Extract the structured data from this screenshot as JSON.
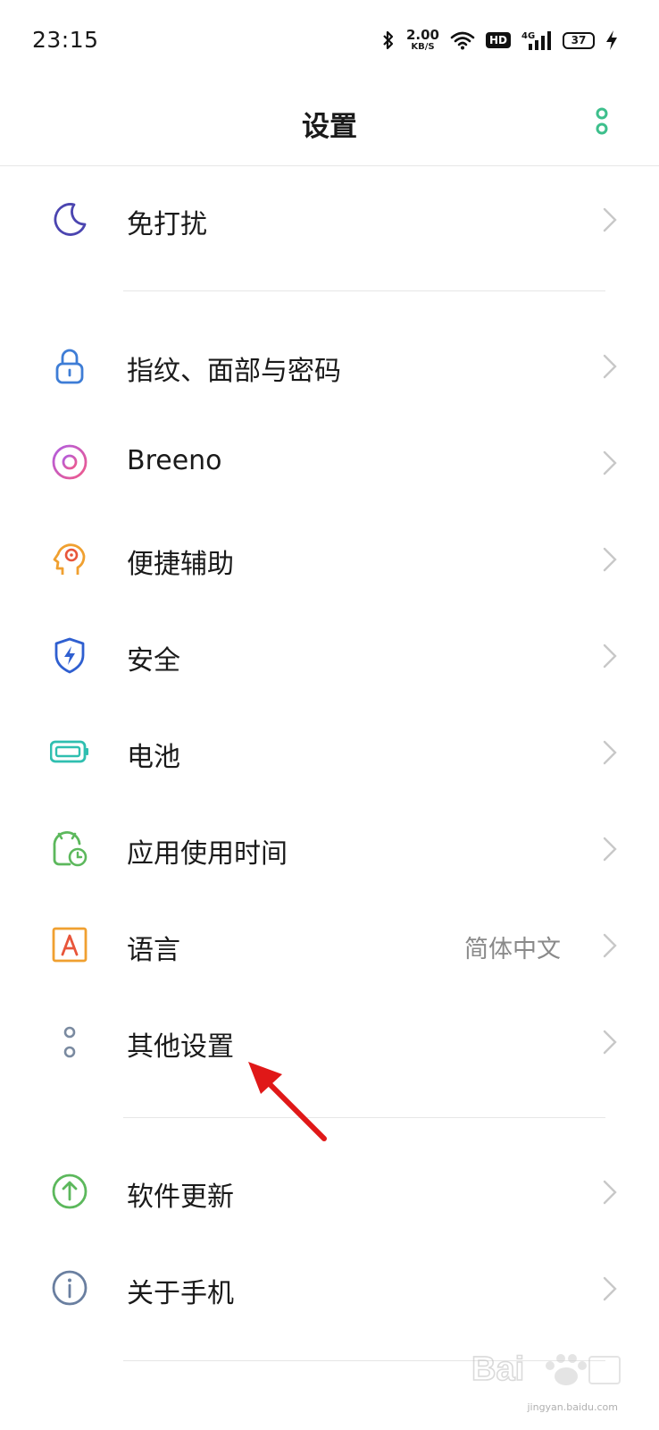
{
  "status_bar": {
    "time": "23:15",
    "net_speed_value": "2.00",
    "net_speed_unit": "KB/S",
    "hd_label": "HD",
    "network_label": "4G",
    "battery_level": "37"
  },
  "header": {
    "title": "设置"
  },
  "settings": {
    "items": [
      {
        "label": "免打扰",
        "icon": "moon-icon"
      },
      {
        "label": "指纹、面部与密码",
        "icon": "lock-icon"
      },
      {
        "label": "Breeno",
        "icon": "breeno-icon"
      },
      {
        "label": "便捷辅助",
        "icon": "assist-head-icon"
      },
      {
        "label": "安全",
        "icon": "shield-icon"
      },
      {
        "label": "电池",
        "icon": "battery-icon"
      },
      {
        "label": "应用使用时间",
        "icon": "app-timer-icon"
      },
      {
        "label": "语言",
        "value": "简体中文",
        "icon": "language-icon"
      },
      {
        "label": "其他设置",
        "icon": "dots-icon"
      },
      {
        "label": "软件更新",
        "icon": "update-arrow-icon"
      },
      {
        "label": "关于手机",
        "icon": "info-icon"
      }
    ]
  },
  "watermark": {
    "sub": "jingyan.baidu.com"
  },
  "colors": {
    "accent": "#3dbf8c",
    "moon": "#4b45b0",
    "lock": "#3e7dd6",
    "breeno": "#c05cd6",
    "assist": "#f0a030",
    "shield": "#2f5fd0",
    "battery": "#2fbfb0",
    "app_timer": "#5cb85c",
    "language": "#f0a030",
    "dots": "#7a8aa0",
    "update": "#5cb85c",
    "info": "#6a7fa0",
    "annotation": "#e01818"
  }
}
